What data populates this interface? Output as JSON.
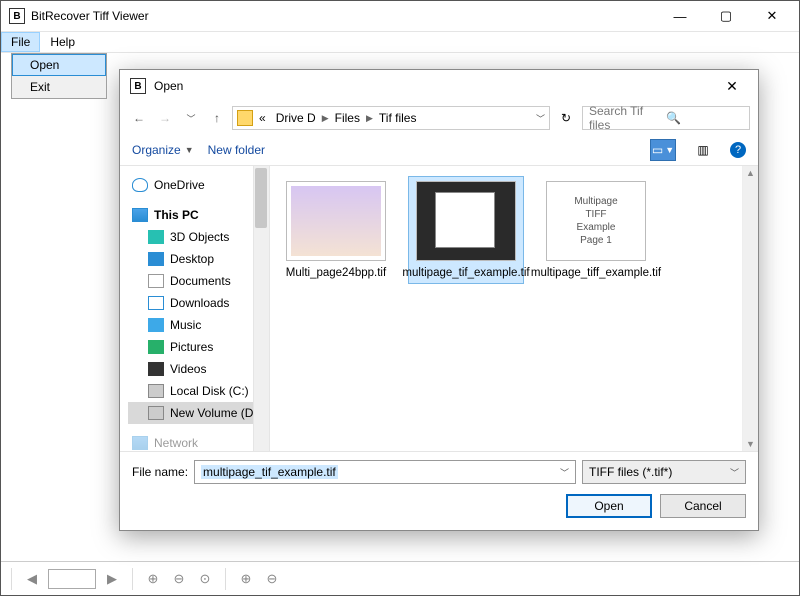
{
  "mainWindow": {
    "title": "BitRecover Tiff Viewer",
    "logoLetter": "B",
    "menuBar": {
      "file": "File",
      "help": "Help"
    },
    "fileMenu": {
      "open": "Open",
      "exit": "Exit"
    },
    "statusBar": {
      "pageValue": ""
    }
  },
  "dialog": {
    "title": "Open",
    "logoLetter": "B",
    "breadcrumb": {
      "ellipsis": "«",
      "seg1": "Drive D",
      "seg2": "Files",
      "seg3": "Tif files"
    },
    "search": {
      "placeholder": "Search Tif files"
    },
    "toolbar": {
      "organize": "Organize",
      "newFolder": "New folder"
    },
    "tree": {
      "onedrive": "OneDrive",
      "thispc": "This PC",
      "items": [
        "3D Objects",
        "Desktop",
        "Documents",
        "Downloads",
        "Music",
        "Pictures",
        "Videos",
        "Local Disk (C:)",
        "New Volume (D:"
      ],
      "network": "Network"
    },
    "files": [
      {
        "name": "Multi_page24bpp.tif",
        "selected": false,
        "thumbStyle": "sample"
      },
      {
        "name": "multipage_tif_example.tif",
        "selected": true,
        "thumbStyle": "dark"
      },
      {
        "name": "multipage_tiff_example.tif",
        "selected": false,
        "thumbStyle": "text",
        "thumbText": "Multipage\nTIFF\nExample\nPage 1"
      }
    ],
    "bottom": {
      "fileNameLabel": "File name:",
      "fileNameValue": "multipage_tif_example.tif",
      "filter": "TIFF files (*.tif*)",
      "openBtn": "Open",
      "cancelBtn": "Cancel"
    }
  }
}
